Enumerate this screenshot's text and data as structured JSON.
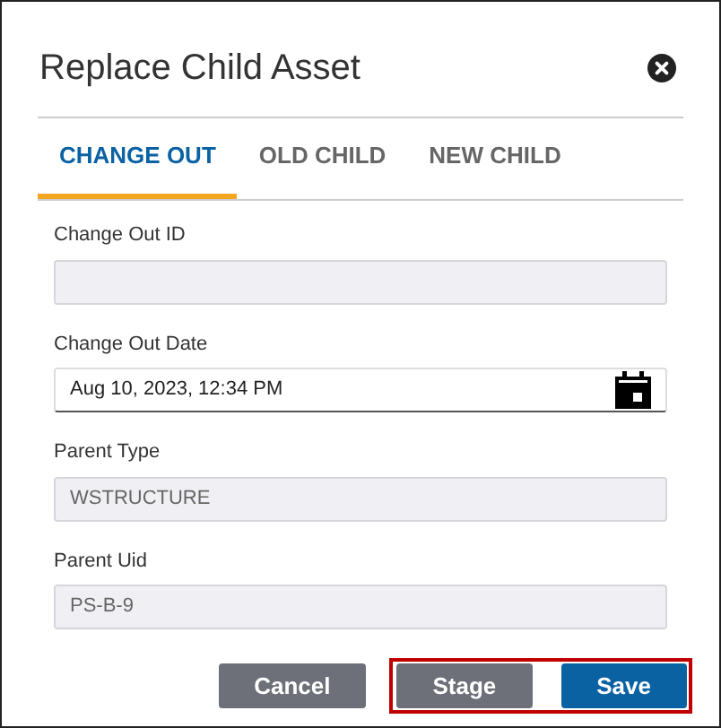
{
  "dialog": {
    "title": "Replace Child Asset"
  },
  "tabs": [
    {
      "label": "CHANGE OUT",
      "selected": true
    },
    {
      "label": "OLD CHILD",
      "selected": false
    },
    {
      "label": "NEW CHILD",
      "selected": false
    }
  ],
  "fields": [
    {
      "kind": "text",
      "label": "Change Out ID",
      "disabled": true
    },
    {
      "kind": "date",
      "label": "Change Out Date",
      "value": "Aug 10, 2023, 12:34 PM",
      "disabled": false
    },
    {
      "kind": "text",
      "label": "Parent Type",
      "value": "WSTRUCTURE",
      "disabled": true
    },
    {
      "kind": "text",
      "label": "Parent Uid",
      "value": "PS-B-9",
      "disabled": true
    }
  ],
  "buttons": [
    {
      "label": "Cancel",
      "kind": "secondary",
      "highlighted": false
    },
    {
      "label": "Stage",
      "kind": "secondary",
      "highlighted": true
    },
    {
      "label": "Save",
      "kind": "primary",
      "highlighted": true
    }
  ]
}
